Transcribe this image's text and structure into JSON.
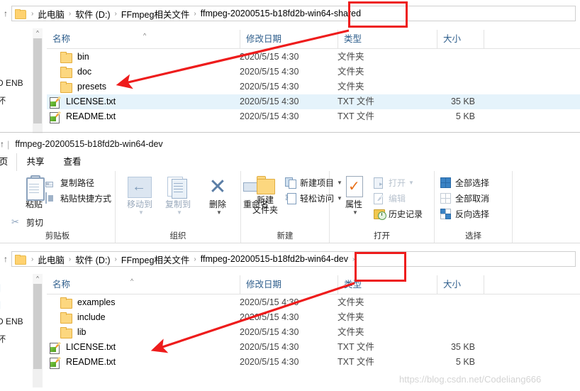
{
  "window_top": {
    "breadcrumb": {
      "up_icon": "up-arrow-icon",
      "folder_icon": "folder-icon",
      "items": [
        "此电脑",
        "软件 (D:)",
        "FFmpeg相关文件",
        "ffmpeg-20200515-b18fd2b-win64-shared"
      ],
      "separator": "›"
    },
    "columns": [
      {
        "label": "名称",
        "sort_indicator": "^"
      },
      {
        "label": "修改日期"
      },
      {
        "label": "类型"
      },
      {
        "label": "大小"
      }
    ],
    "rows": [
      {
        "name": "bin",
        "icon": "folder-icon",
        "date": "2020/5/15 4:30",
        "type": "文件夹",
        "size": "",
        "selected": false
      },
      {
        "name": "doc",
        "icon": "folder-icon",
        "date": "2020/5/15 4:30",
        "type": "文件夹",
        "size": "",
        "selected": false
      },
      {
        "name": "presets",
        "icon": "folder-icon",
        "date": "2020/5/15 4:30",
        "type": "文件夹",
        "size": "",
        "selected": false
      },
      {
        "name": "LICENSE.txt",
        "icon": "text-file-icon",
        "date": "2020/5/15 4:30",
        "type": "TXT 文件",
        "size": "35 KB",
        "selected": true
      },
      {
        "name": "README.txt",
        "icon": "text-file-icon",
        "date": "2020/5/15 4:30",
        "type": "TXT 文件",
        "size": "5 KB",
        "selected": false
      }
    ],
    "sidebar_fragments": [
      "D ENB",
      "坏"
    ],
    "scrollbar_up": "^"
  },
  "window_bottom": {
    "title": "ffmpeg-20200515-b18fd2b-win64-dev",
    "title_up_icon": "up-arrow-icon",
    "tabs": [
      {
        "label": "页",
        "active": true
      },
      {
        "label": "共享",
        "active": false
      },
      {
        "label": "查看",
        "active": false
      }
    ],
    "ribbon": {
      "groups": [
        {
          "label": "剪贴板",
          "big_buttons": [
            {
              "label": "粘贴",
              "icon": "clipboard-icon",
              "lines": [
                "粘贴"
              ]
            }
          ],
          "small_buttons": [
            {
              "label": "复制路径",
              "icon": "copy-path-icon"
            },
            {
              "label": "粘贴快捷方式",
              "icon": "paste-shortcut-icon"
            },
            {
              "label": "剪切",
              "icon": "scissors-icon"
            }
          ]
        },
        {
          "label": "组织",
          "big_buttons": [
            {
              "label": "移动到",
              "icon": "move-to-icon",
              "dropdown": true,
              "dim": true
            },
            {
              "label": "复制到",
              "icon": "copy-to-icon",
              "dropdown": true,
              "dim": true
            },
            {
              "label": "删除",
              "icon": "delete-x-icon",
              "dropdown": true,
              "dim": false
            },
            {
              "label": "重命名",
              "icon": "rename-icon",
              "dropdown": false,
              "dim": false
            }
          ]
        },
        {
          "label": "新建",
          "big_buttons": [
            {
              "label": "新建\n文件夹",
              "icon": "new-folder-icon",
              "lines": [
                "新建",
                "文件夹"
              ]
            }
          ],
          "small_buttons": [
            {
              "label": "新建项目",
              "icon": "new-item-icon",
              "dropdown": true
            },
            {
              "label": "轻松访问",
              "icon": "easy-access-icon",
              "dropdown": true
            }
          ]
        },
        {
          "label": "打开",
          "big_buttons": [
            {
              "label": "属性",
              "icon": "properties-icon",
              "dropdown": true,
              "lines": [
                "属性"
              ]
            }
          ],
          "small_buttons": [
            {
              "label": "打开",
              "icon": "open-icon",
              "dropdown": true,
              "dim": true
            },
            {
              "label": "编辑",
              "icon": "edit-icon",
              "dim": true
            },
            {
              "label": "历史记录",
              "icon": "history-icon",
              "dim": false
            }
          ]
        },
        {
          "label": "选择",
          "small_buttons": [
            {
              "label": "全部选择",
              "icon": "select-all-icon"
            },
            {
              "label": "全部取消",
              "icon": "select-none-icon"
            },
            {
              "label": "反向选择",
              "icon": "invert-selection-icon"
            }
          ]
        }
      ]
    },
    "breadcrumb": {
      "up_icon": "up-arrow-icon",
      "folder_icon": "folder-icon",
      "items": [
        "此电脑",
        "软件 (D:)",
        "FFmpeg相关文件",
        "ffmpeg-20200515-b18fd2b-win64-dev"
      ],
      "separator": "›",
      "trailing_separator": "›"
    },
    "columns": [
      {
        "label": "名称",
        "sort_indicator": "^"
      },
      {
        "label": "修改日期"
      },
      {
        "label": "类型"
      },
      {
        "label": "大小"
      }
    ],
    "rows": [
      {
        "name": "examples",
        "icon": "folder-icon",
        "date": "2020/5/15 4:30",
        "type": "文件夹",
        "size": "",
        "selected": false
      },
      {
        "name": "include",
        "icon": "folder-icon",
        "date": "2020/5/15 4:30",
        "type": "文件夹",
        "size": "",
        "selected": false
      },
      {
        "name": "lib",
        "icon": "folder-icon",
        "date": "2020/5/15 4:30",
        "type": "文件夹",
        "size": "",
        "selected": false
      },
      {
        "name": "LICENSE.txt",
        "icon": "text-file-icon",
        "date": "2020/5/15 4:30",
        "type": "TXT 文件",
        "size": "35 KB",
        "selected": false
      },
      {
        "name": "README.txt",
        "icon": "text-file-icon",
        "date": "2020/5/15 4:30",
        "type": "TXT 文件",
        "size": "5 KB",
        "selected": false
      }
    ],
    "sidebar_fragments": [
      "D ENB",
      "坏"
    ],
    "scrollbar_up": "^"
  },
  "annotations": {
    "highlight_color": "#ee1c1c",
    "box_top_label": "win64-shared",
    "box_bottom_label": "win64-dev",
    "arrow_count": 2
  },
  "watermark": "https://blog.csdn.net/Codeliang666"
}
